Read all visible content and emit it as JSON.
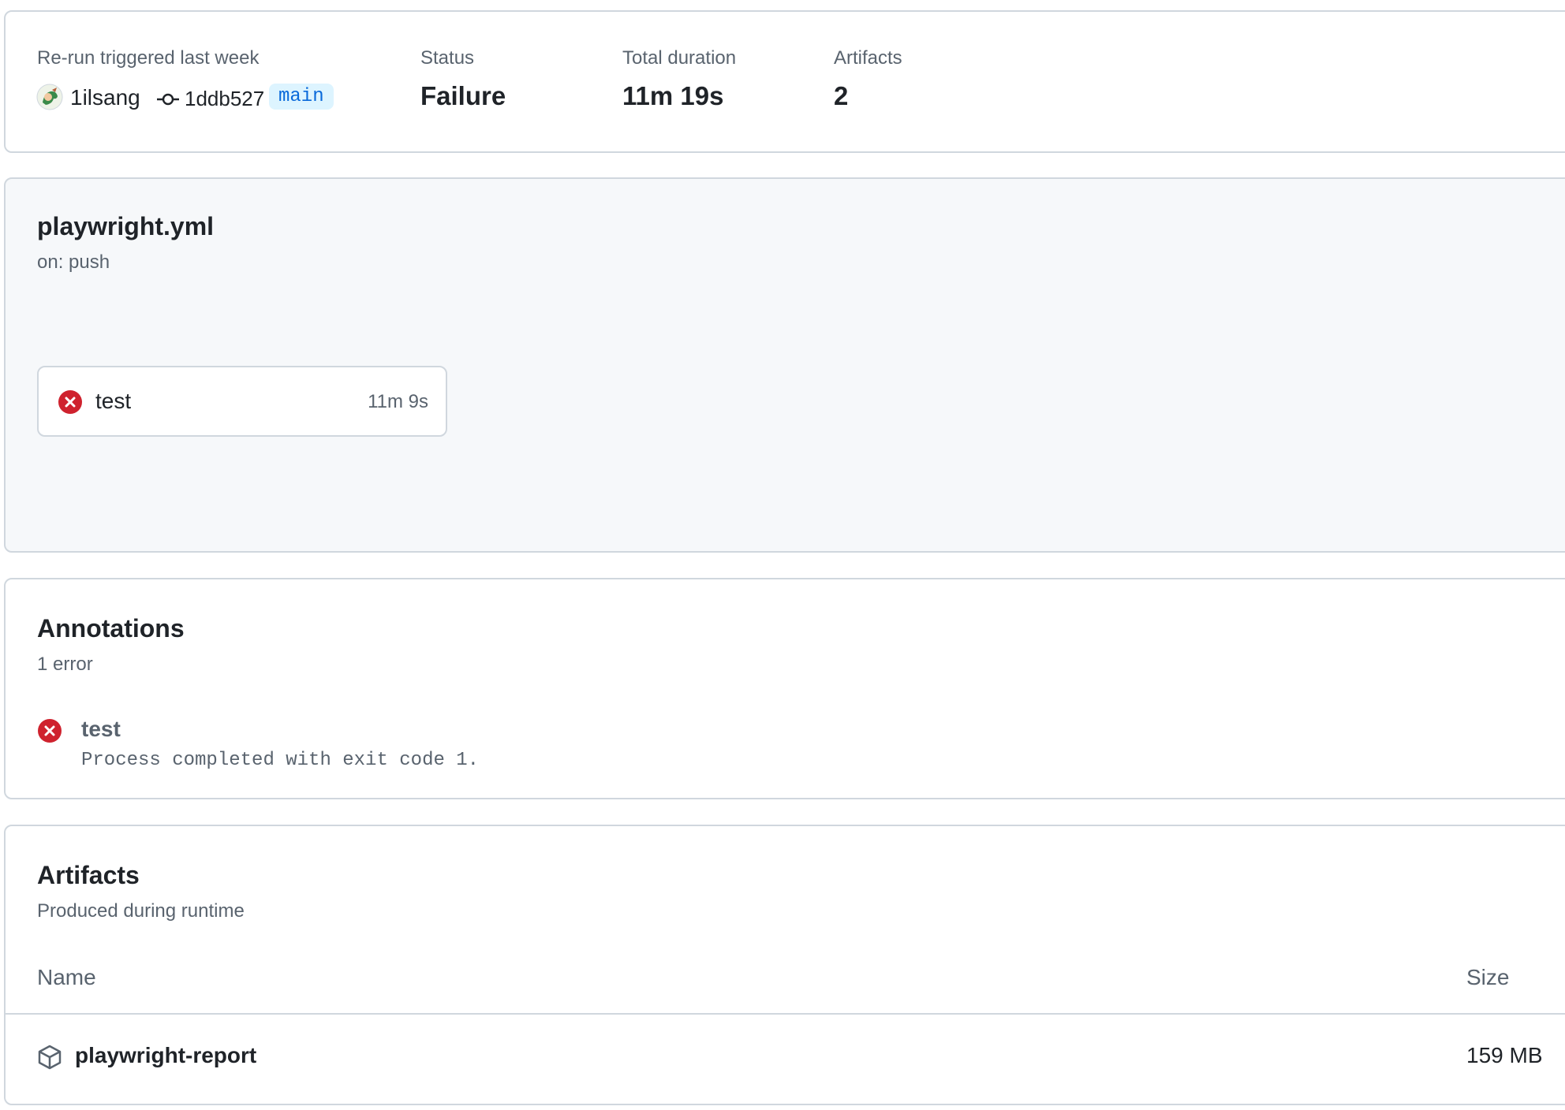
{
  "summary": {
    "trigger_label": "Re-run triggered last week",
    "actor": "1ilsang",
    "commit_sha": "1ddb527",
    "branch": "main",
    "status_label": "Status",
    "status_value": "Failure",
    "duration_label": "Total duration",
    "duration_value": "11m 19s",
    "artifacts_label": "Artifacts",
    "artifacts_value": "2"
  },
  "workflow": {
    "file": "playwright.yml",
    "trigger": "on: push",
    "jobs": [
      {
        "name": "test",
        "duration": "11m 9s",
        "status": "failure"
      }
    ]
  },
  "annotations": {
    "title": "Annotations",
    "count": "1 error",
    "items": [
      {
        "title": "test",
        "message": "Process completed with exit code 1.",
        "level": "error"
      }
    ]
  },
  "artifacts": {
    "title": "Artifacts",
    "subtitle": "Produced during runtime",
    "columns": {
      "name": "Name",
      "size": "Size"
    },
    "rows": [
      {
        "name": "playwright-report",
        "size": "159 MB"
      }
    ]
  },
  "colors": {
    "error": "#cf222e",
    "branch_bg": "#ddf4ff",
    "branch_fg": "#0969da",
    "border": "#d0d7de",
    "muted": "#59636e"
  },
  "icons": {
    "actor": "avatar",
    "commit": "git-commit-icon",
    "job_status": "x-circle-fill-icon",
    "annotation": "x-circle-fill-icon",
    "artifact": "package-icon"
  }
}
